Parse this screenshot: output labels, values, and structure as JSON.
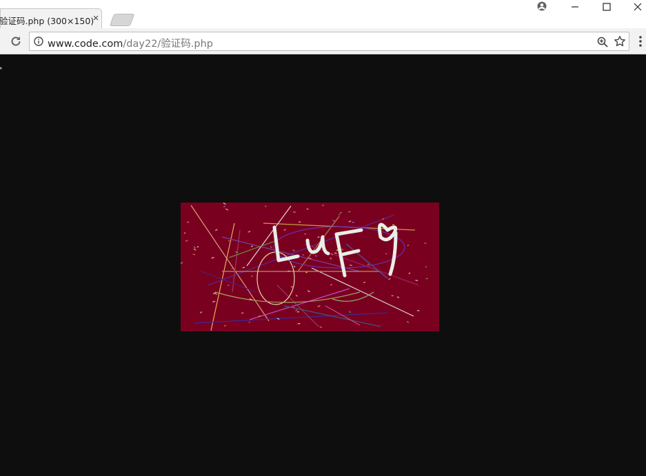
{
  "tab": {
    "title": "验证码.php (300×150)",
    "close_glyph": "×"
  },
  "window_controls": {
    "minimize": "—",
    "maximize": "☐",
    "close": "✕"
  },
  "address_bar": {
    "host": "www.code.com",
    "path": "/day22/验证码.php"
  },
  "captcha": {
    "text": "LuF9",
    "background_color": "#7a0020",
    "text_color": "#e9eee6"
  },
  "colors": {
    "page_background": "#0e0e0e",
    "toolbar": "#f2f2f2"
  }
}
